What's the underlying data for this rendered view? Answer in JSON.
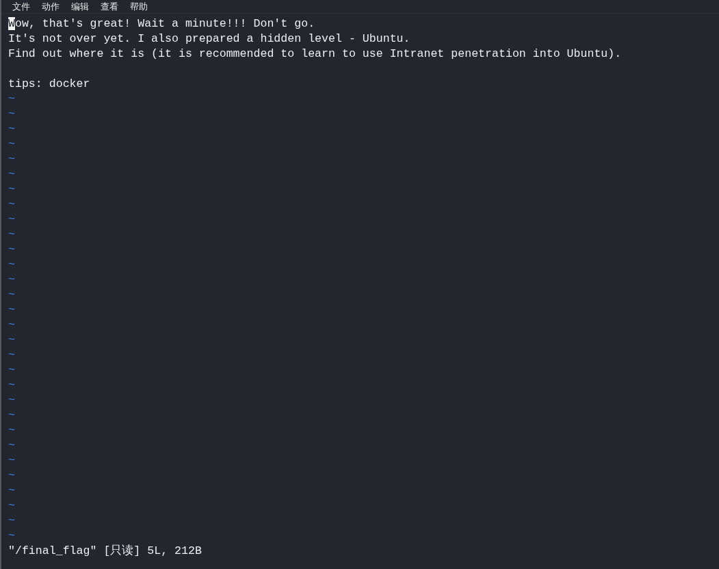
{
  "menu": [
    "文件",
    "动作",
    "编辑",
    "查看",
    "帮助"
  ],
  "editor": {
    "lines": [
      {
        "text": "Wow, that's great! Wait a minute!!! Don't go.",
        "cursor": true
      },
      {
        "text": "It's not over yet. I also prepared a hidden level - Ubuntu.",
        "cursor": false
      },
      {
        "text": "Find out where it is (it is recommended to learn to use Intranet penetration into Ubuntu).",
        "cursor": false
      },
      {
        "cursor": false
      },
      {
        "text": "tips: docker",
        "cursor": false
      }
    ],
    "empty_line_markers": [
      "~",
      "~",
      "~",
      "~",
      "~",
      "~",
      "~",
      "~",
      "~",
      "~",
      "~",
      "~",
      "~",
      "~",
      "~",
      "~",
      "~",
      "~",
      "~",
      "~",
      "~",
      "~",
      "~",
      "~",
      "~",
      "~",
      "~",
      "~",
      "~",
      "~"
    ]
  },
  "status_line": "\"/final_flag\" [只读] 5L, 212B"
}
